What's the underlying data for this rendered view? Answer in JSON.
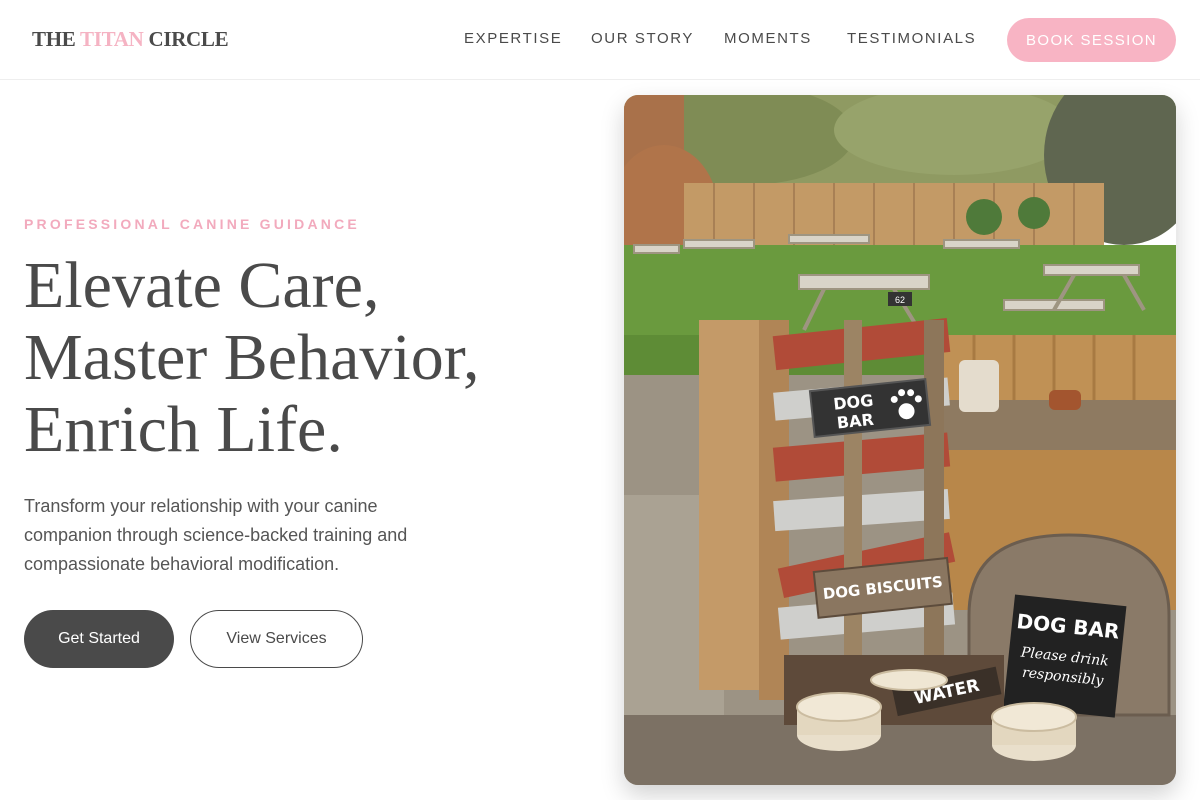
{
  "brand": {
    "part1": "THE ",
    "accent": "TITAN",
    "part2": " CIRCLE"
  },
  "nav": {
    "expertise": "EXPERTISE",
    "story": "OUR STORY",
    "moments": "MOMENTS",
    "testimonials": "TESTIMONIALS",
    "cta": "BOOK SESSION"
  },
  "hero": {
    "eyebrow": "PROFESSIONAL CANINE GUIDANCE",
    "headline": [
      "Elevate Care,",
      "Master Behavior,",
      "Enrich Life."
    ],
    "description": "Transform your relationship with your canine companion through science-backed training and compassionate behavioral modification.",
    "primary_button": "Get Started",
    "secondary_button": "View Services"
  },
  "photo": {
    "sign_top": [
      "DOG",
      "BAR"
    ],
    "sign_biscuits": "DOG BISCUITS",
    "sign_board": [
      "DOG BAR",
      "Please drink",
      "responsibly"
    ],
    "sign_water": "WATER",
    "table_number": "62"
  },
  "colors": {
    "accent_pink": "#f8b4c4",
    "text_dark": "#4a4a4a"
  }
}
